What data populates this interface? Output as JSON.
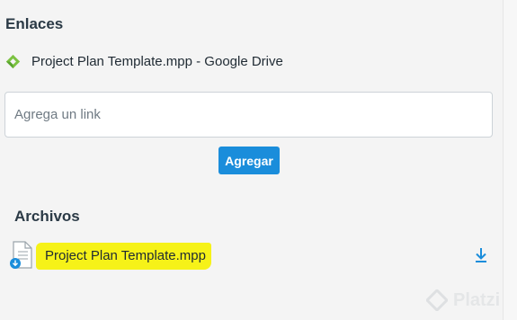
{
  "links": {
    "title": "Enlaces",
    "items": [
      {
        "label": "Project Plan Template.mpp - Google Drive",
        "icon": "google-drive-icon"
      }
    ],
    "input": {
      "placeholder": "Agrega un link",
      "value": ""
    },
    "add_button": "Agregar"
  },
  "files": {
    "title": "Archivos",
    "items": [
      {
        "name": "Project Plan Template.mpp",
        "icon": "file-download-icon",
        "action_icon": "download-icon"
      }
    ]
  },
  "watermark": {
    "text": "Platzi"
  },
  "colors": {
    "accent_button": "#1a8ddb",
    "highlight": "#f6f218",
    "drive_green": "#7cc242",
    "download_blue": "#1a8ddb"
  }
}
